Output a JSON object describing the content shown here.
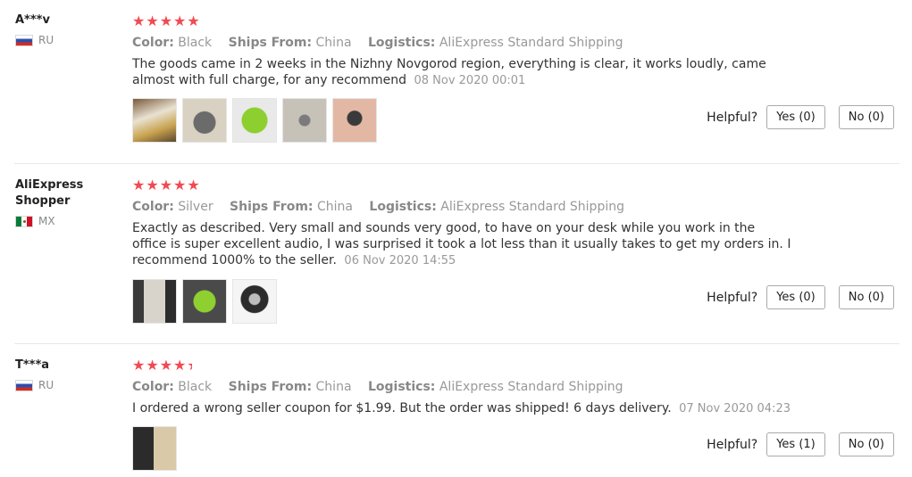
{
  "labels": {
    "color": "Color:",
    "ships_from": "Ships From:",
    "logistics": "Logistics:",
    "helpful": "Helpful?"
  },
  "colors": {
    "star": "#f04a53",
    "divider": "#e8e8e8"
  },
  "reviews": [
    {
      "user": "A***v",
      "country": "RU",
      "rating": 5,
      "color": "Black",
      "ships_from": "China",
      "logistics": "AliExpress Standard Shipping",
      "text": "The goods came in 2 weeks in the Nizhny Novgorod region, everything is clear, it works loudly, came almost with full charge, for any recommend",
      "date": "08 Nov 2020 00:01",
      "yes": "Yes (0)",
      "no": "No (0)",
      "photos": 5
    },
    {
      "user": "AliExpress Shopper",
      "country": "MX",
      "rating": 5,
      "color": "Silver",
      "ships_from": "China",
      "logistics": "AliExpress Standard Shipping",
      "text": "Exactly as described. Very small and sounds very good, to have on your desk while you work in the office is super excellent audio, I was surprised it took a lot less than it usually takes to get my orders in. I recommend 1000% to the seller.",
      "date": "06 Nov 2020 14:55",
      "yes": "Yes (0)",
      "no": "No (0)",
      "photos": 3
    },
    {
      "user": "T***a",
      "country": "RU",
      "rating": 4.5,
      "color": "Black",
      "ships_from": "China",
      "logistics": "AliExpress Standard Shipping",
      "text": "I ordered a wrong seller coupon for $1.99. But the order was shipped! 6 days delivery.",
      "date": "07 Nov 2020 04:23",
      "yes": "Yes (1)",
      "no": "No (0)",
      "photos": 1
    }
  ]
}
